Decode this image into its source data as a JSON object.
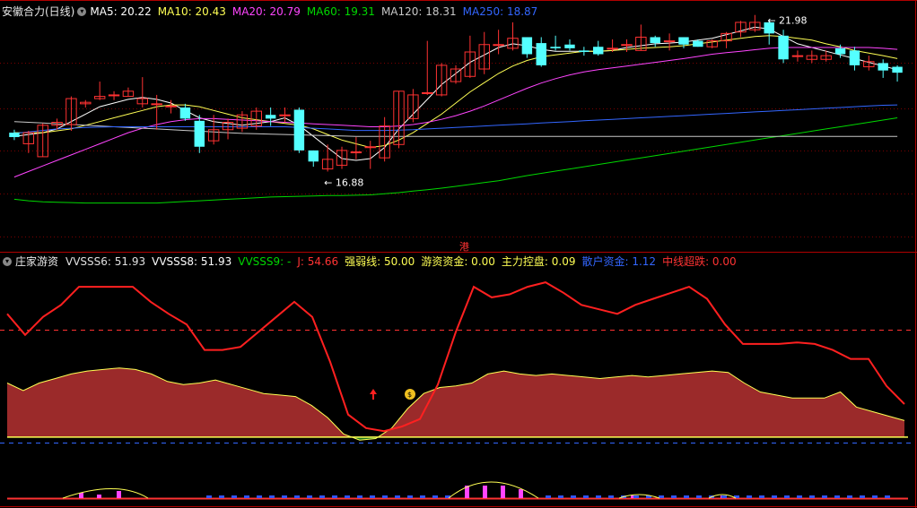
{
  "price_header": {
    "title": "安徽合力(日线)",
    "items": [
      {
        "label": "MA5: 20.22",
        "color": "#ffffff"
      },
      {
        "label": "MA10: 20.43",
        "color": "#ffff54"
      },
      {
        "label": "MA20: 20.79",
        "color": "#ff45ff"
      },
      {
        "label": "MA60: 19.31",
        "color": "#00d800"
      },
      {
        "label": "MA120: 18.31",
        "color": "#c8c8c8"
      },
      {
        "label": "MA250: 18.87",
        "color": "#3366ff"
      }
    ]
  },
  "ind_header": {
    "title": "庄家游资",
    "items": [
      {
        "label": "VVSSS6: 51.93",
        "color": "#e0e0e0"
      },
      {
        "label": "VVSSS8: 51.93",
        "color": "#ffffff"
      },
      {
        "label": "VVSSS9: -",
        "color": "#00d800"
      },
      {
        "label": "J: 54.66",
        "color": "#ff3333"
      },
      {
        "label": "强弱线: 50.00",
        "color": "#ffff54"
      },
      {
        "label": "游资资金: 0.00",
        "color": "#ffff54"
      },
      {
        "label": "主力控盘: 0.09",
        "color": "#ffff54"
      },
      {
        "label": "散户资金: 1.12",
        "color": "#3366ff"
      },
      {
        "label": "中线超跌: 0.00",
        "color": "#ff3333"
      }
    ]
  },
  "annotations": {
    "high": "21.98",
    "low": "16.88",
    "marker": "港"
  },
  "chart_data": {
    "type": "candlestick",
    "price_range": [
      16.5,
      22.6
    ],
    "candles": [
      [
        19.5,
        19.38,
        19.58,
        19.3
      ],
      [
        19.2,
        19.5,
        19.55,
        18.95
      ],
      [
        18.85,
        19.7,
        19.75,
        18.85
      ],
      [
        19.7,
        19.78,
        19.88,
        19.58
      ],
      [
        19.72,
        20.42,
        20.48,
        19.55
      ],
      [
        20.28,
        20.32,
        20.38,
        20.18
      ],
      [
        20.42,
        20.48,
        20.88,
        20.38
      ],
      [
        20.52,
        20.52,
        20.62,
        20.38
      ],
      [
        20.48,
        20.62,
        20.72,
        20.48
      ],
      [
        20.28,
        20.42,
        21.0,
        20.18
      ],
      [
        20.28,
        20.28,
        20.52,
        19.58
      ],
      [
        20.22,
        20.22,
        20.38,
        20.02
      ],
      [
        20.18,
        19.88,
        20.28,
        19.82
      ],
      [
        19.82,
        19.12,
        19.98,
        18.95
      ],
      [
        19.28,
        19.58,
        19.98,
        19.18
      ],
      [
        19.58,
        19.78,
        19.88,
        19.32
      ],
      [
        19.62,
        19.98,
        20.08,
        19.52
      ],
      [
        19.68,
        20.08,
        20.18,
        19.58
      ],
      [
        19.98,
        19.88,
        20.18,
        19.68
      ],
      [
        19.98,
        19.98,
        20.18,
        19.78
      ],
      [
        20.12,
        19.02,
        20.18,
        18.95
      ],
      [
        19.02,
        18.72,
        19.02,
        18.58
      ],
      [
        18.52,
        18.78,
        19.18,
        18.45
      ],
      [
        18.62,
        19.02,
        19.12,
        18.52
      ],
      [
        18.98,
        18.98,
        19.38,
        18.78
      ],
      [
        19.12,
        19.12,
        19.28,
        18.52
      ],
      [
        18.82,
        19.68,
        19.92,
        18.72
      ],
      [
        19.18,
        20.62,
        20.62,
        19.08
      ],
      [
        19.88,
        20.52,
        20.68,
        19.78
      ],
      [
        20.58,
        20.58,
        21.98,
        20.52
      ],
      [
        20.52,
        21.32,
        21.38,
        20.48
      ],
      [
        20.88,
        21.22,
        21.32,
        20.82
      ],
      [
        21.02,
        21.68,
        22.12,
        20.98
      ],
      [
        21.22,
        21.88,
        22.22,
        21.08
      ],
      [
        21.88,
        21.88,
        22.28,
        21.62
      ],
      [
        21.78,
        22.05,
        22.48,
        21.72
      ],
      [
        22.08,
        21.62,
        22.08,
        21.52
      ],
      [
        21.92,
        21.32,
        22.08,
        21.28
      ],
      [
        21.82,
        21.78,
        22.12,
        21.72
      ],
      [
        21.88,
        21.78,
        22.02,
        21.72
      ],
      [
        21.72,
        21.68,
        21.82,
        21.58
      ],
      [
        21.82,
        21.62,
        21.98,
        21.58
      ],
      [
        21.78,
        21.78,
        22.02,
        21.68
      ],
      [
        21.88,
        21.88,
        22.02,
        21.68
      ],
      [
        21.72,
        22.08,
        22.42,
        21.72
      ],
      [
        22.08,
        21.92,
        22.12,
        21.82
      ],
      [
        21.98,
        21.98,
        22.18,
        21.72
      ],
      [
        22.08,
        21.88,
        22.08,
        21.78
      ],
      [
        21.98,
        21.82,
        22.02,
        21.82
      ],
      [
        21.82,
        21.98,
        22.02,
        21.78
      ],
      [
        21.98,
        22.18,
        22.22,
        21.78
      ],
      [
        22.22,
        22.48,
        22.52,
        22.08
      ],
      [
        22.28,
        22.48,
        22.68,
        22.22
      ],
      [
        22.48,
        22.18,
        22.52,
        21.88
      ],
      [
        22.12,
        21.48,
        22.28,
        21.38
      ],
      [
        21.58,
        21.58,
        21.72,
        21.42
      ],
      [
        21.48,
        21.58,
        21.72,
        21.38
      ],
      [
        21.48,
        21.58,
        21.72,
        21.42
      ],
      [
        21.78,
        21.62,
        21.88,
        21.52
      ],
      [
        21.72,
        21.32,
        21.82,
        21.18
      ],
      [
        21.28,
        21.42,
        21.58,
        21.18
      ],
      [
        21.38,
        21.18,
        21.48,
        20.98
      ],
      [
        21.28,
        21.12,
        21.32,
        20.88
      ]
    ],
    "ma_series": [
      {
        "name": "MA5",
        "values": [
          19.4,
          19.45,
          19.5,
          19.6,
          19.8,
          20.0,
          20.2,
          20.3,
          20.4,
          20.45,
          20.4,
          20.3,
          20.1,
          19.9,
          19.8,
          19.75,
          19.7,
          19.75,
          19.8,
          19.9,
          19.7,
          19.4,
          19.1,
          18.8,
          18.75,
          18.8,
          19.1,
          19.6,
          20.0,
          20.4,
          20.8,
          21.1,
          21.4,
          21.6,
          21.8,
          21.9,
          21.85,
          21.75,
          21.7,
          21.7,
          21.7,
          21.7,
          21.72,
          21.8,
          21.85,
          21.9,
          21.92,
          21.95,
          22.0,
          22.05,
          22.15,
          22.25,
          22.35,
          22.3,
          22.1,
          21.9,
          21.8,
          21.7,
          21.6,
          21.5,
          21.4,
          21.3,
          21.2
        ]
      },
      {
        "name": "MA10",
        "values": [
          19.5,
          19.5,
          19.5,
          19.55,
          19.6,
          19.7,
          19.8,
          19.9,
          20.0,
          20.1,
          20.2,
          20.25,
          20.25,
          20.2,
          20.1,
          20.0,
          19.9,
          19.85,
          19.8,
          19.75,
          19.7,
          19.6,
          19.45,
          19.3,
          19.2,
          19.1,
          19.15,
          19.3,
          19.5,
          19.75,
          20.0,
          20.3,
          20.6,
          20.85,
          21.1,
          21.3,
          21.45,
          21.55,
          21.6,
          21.65,
          21.7,
          21.7,
          21.72,
          21.75,
          21.78,
          21.8,
          21.82,
          21.85,
          21.9,
          21.95,
          22.0,
          22.05,
          22.1,
          22.12,
          22.1,
          22.05,
          22.0,
          21.9,
          21.82,
          21.72,
          21.65,
          21.58,
          21.5
        ]
      },
      {
        "name": "MA20",
        "values": [
          18.3,
          18.45,
          18.6,
          18.75,
          18.9,
          19.05,
          19.2,
          19.35,
          19.5,
          19.62,
          19.72,
          19.8,
          19.85,
          19.88,
          19.88,
          19.86,
          19.84,
          19.82,
          19.8,
          19.78,
          19.76,
          19.74,
          19.72,
          19.7,
          19.68,
          19.66,
          19.66,
          19.68,
          19.72,
          19.78,
          19.86,
          19.96,
          20.08,
          20.22,
          20.38,
          20.54,
          20.7,
          20.84,
          20.96,
          21.06,
          21.14,
          21.2,
          21.25,
          21.3,
          21.35,
          21.4,
          21.45,
          21.5,
          21.56,
          21.62,
          21.66,
          21.7,
          21.74,
          21.78,
          21.8,
          21.8,
          21.8,
          21.8,
          21.8,
          21.8,
          21.8,
          21.78,
          21.75
        ]
      },
      {
        "name": "MA60",
        "values": [
          17.7,
          17.66,
          17.63,
          17.62,
          17.61,
          17.6,
          17.6,
          17.6,
          17.6,
          17.6,
          17.6,
          17.62,
          17.64,
          17.66,
          17.68,
          17.7,
          17.72,
          17.74,
          17.76,
          17.77,
          17.78,
          17.79,
          17.8,
          17.8,
          17.81,
          17.82,
          17.85,
          17.88,
          17.92,
          17.96,
          18.0,
          18.05,
          18.1,
          18.15,
          18.2,
          18.27,
          18.34,
          18.4,
          18.46,
          18.52,
          18.58,
          18.64,
          18.7,
          18.76,
          18.82,
          18.88,
          18.94,
          19.0,
          19.06,
          19.12,
          19.18,
          19.24,
          19.3,
          19.36,
          19.42,
          19.48,
          19.54,
          19.6,
          19.66,
          19.72,
          19.78,
          19.84,
          19.9
        ]
      },
      {
        "name": "MA120",
        "values": [
          19.8,
          19.78,
          19.76,
          19.74,
          19.72,
          19.7,
          19.68,
          19.66,
          19.64,
          19.62,
          19.6,
          19.58,
          19.56,
          19.54,
          19.52,
          19.5,
          19.48,
          19.47,
          19.46,
          19.45,
          19.44,
          19.43,
          19.42,
          19.41,
          19.4,
          19.4,
          19.4,
          19.4,
          19.4,
          19.4,
          19.4,
          19.4,
          19.4,
          19.4,
          19.4,
          19.4,
          19.4,
          19.4,
          19.4,
          19.4,
          19.4,
          19.4,
          19.4,
          19.4,
          19.4,
          19.4,
          19.4,
          19.4,
          19.4,
          19.4,
          19.4,
          19.4,
          19.4,
          19.4,
          19.4,
          19.4,
          19.4,
          19.4,
          19.4,
          19.4,
          19.4,
          19.4,
          19.4
        ]
      },
      {
        "name": "MA250",
        "values": [
          19.48,
          19.52,
          19.56,
          19.6,
          19.62,
          19.64,
          19.65,
          19.66,
          19.66,
          19.66,
          19.66,
          19.66,
          19.66,
          19.66,
          19.66,
          19.66,
          19.66,
          19.66,
          19.66,
          19.66,
          19.64,
          19.62,
          19.6,
          19.58,
          19.56,
          19.56,
          19.56,
          19.57,
          19.58,
          19.6,
          19.62,
          19.64,
          19.66,
          19.68,
          19.7,
          19.72,
          19.74,
          19.76,
          19.78,
          19.8,
          19.82,
          19.84,
          19.86,
          19.88,
          19.9,
          19.92,
          19.94,
          19.96,
          19.98,
          20.0,
          20.02,
          20.04,
          20.06,
          20.08,
          20.1,
          20.12,
          20.14,
          20.16,
          20.18,
          20.2,
          20.22,
          20.24,
          20.25
        ]
      }
    ],
    "indicator_j": [
      82,
      68,
      80,
      88,
      100,
      100,
      100,
      100,
      90,
      82,
      75,
      58,
      58,
      60,
      70,
      80,
      90,
      80,
      50,
      15,
      6,
      4,
      7,
      12,
      35,
      70,
      100,
      93,
      95,
      100,
      103,
      96,
      88,
      85,
      82,
      88,
      92,
      96,
      100,
      92,
      75,
      62,
      62,
      62,
      63,
      62,
      58,
      52,
      52,
      34,
      22
    ],
    "indicator_area": [
      36,
      31,
      36,
      39,
      42,
      44,
      45,
      46,
      45,
      42,
      37,
      35,
      36,
      38,
      35,
      32,
      29,
      28,
      27,
      21,
      13,
      2,
      -2,
      -1,
      6,
      19,
      29,
      33,
      34,
      36,
      42,
      44,
      42,
      41,
      42,
      41,
      40,
      39,
      40,
      41,
      40,
      41,
      42,
      43,
      44,
      43,
      36,
      30,
      28,
      26,
      26,
      26,
      30,
      20,
      17,
      14,
      11
    ],
    "indicator_ylim": [
      -12,
      112
    ]
  }
}
